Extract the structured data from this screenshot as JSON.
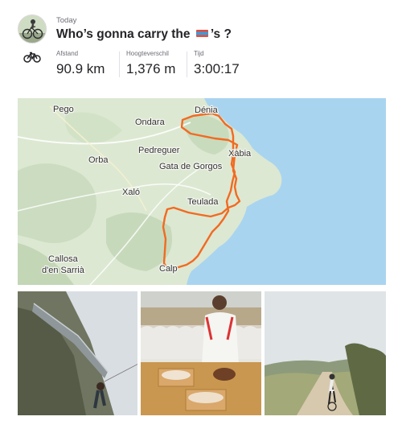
{
  "activity": {
    "date": "Today",
    "title_before": "Who’s gonna carry the",
    "title_emoji": "flag-emoji",
    "title_after": "’s ?",
    "sport_icon": "bike-icon"
  },
  "stats": [
    {
      "label": "Afstand",
      "value": "90.9 km"
    },
    {
      "label": "Hoogteverschil",
      "value": "1,376 m"
    },
    {
      "label": "Tijd",
      "value": "3:00:17"
    }
  ],
  "map": {
    "towns": [
      "Pego",
      "Ondara",
      "Dénia",
      "Orba",
      "Pedreguer",
      "Xàbia",
      "Gata de Gorgos",
      "Xaló",
      "Teulada",
      "Callosa",
      "d'en Sarrià",
      "Calp"
    ],
    "route_color": "#f26a21",
    "sea_color": "#a9d4f0"
  },
  "photos": [
    {
      "name": "photo-rock-climbing",
      "alt": "rock"
    },
    {
      "name": "photo-cafe-pastries",
      "alt": "cafe"
    },
    {
      "name": "photo-road-cyclist",
      "alt": "road"
    }
  ]
}
